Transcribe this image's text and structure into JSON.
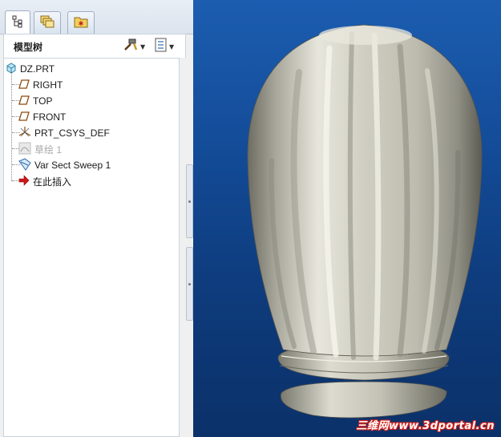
{
  "tabs": [
    {
      "icon": "model-tree-icon"
    },
    {
      "icon": "layers-icon"
    },
    {
      "icon": "favorites-folder-icon"
    }
  ],
  "tree_header": {
    "title": "模型树",
    "settings_icon": "tree-settings-icon",
    "show_icon": "tree-show-icon"
  },
  "tree": {
    "root": {
      "label": "DZ.PRT",
      "icon": "part-icon"
    },
    "items": [
      {
        "label": "RIGHT",
        "icon": "datum-plane-icon",
        "suppressed": false
      },
      {
        "label": "TOP",
        "icon": "datum-plane-icon",
        "suppressed": false
      },
      {
        "label": "FRONT",
        "icon": "datum-plane-icon",
        "suppressed": false
      },
      {
        "label": "PRT_CSYS_DEF",
        "icon": "coordinate-system-icon",
        "suppressed": false
      },
      {
        "label": "草绘 1",
        "icon": "sketch-icon",
        "suppressed": true
      },
      {
        "label": "Var Sect Sweep 1",
        "icon": "var-sect-sweep-icon",
        "suppressed": false
      },
      {
        "label": "在此插入",
        "icon": "insert-here-arrow-icon",
        "suppressed": false
      }
    ]
  },
  "viewport": {
    "background_top": "#1c5db0",
    "background_bottom": "#0b3169",
    "model_color": "#c9c8bb",
    "watermark": "三维网www.3dportal.cn"
  }
}
